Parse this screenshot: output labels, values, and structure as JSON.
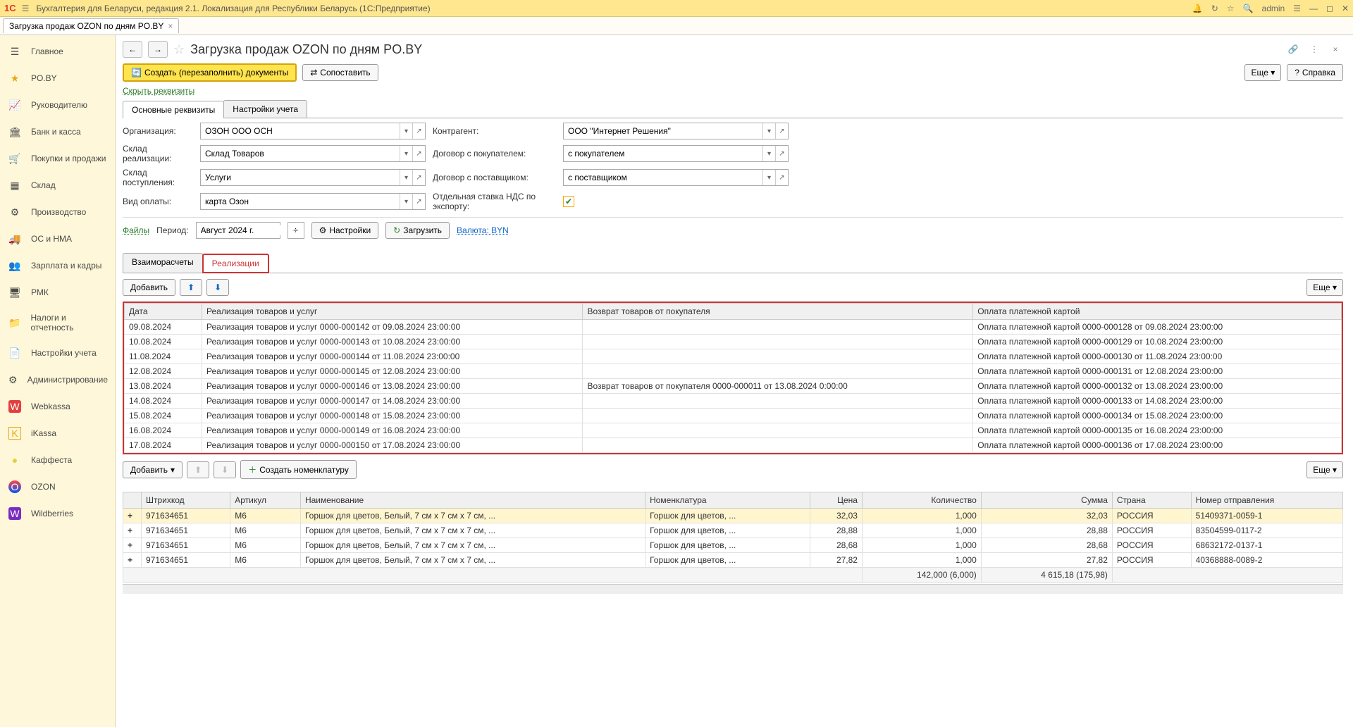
{
  "app": {
    "logo": "1C",
    "title": "Бухгалтерия для Беларуси, редакция 2.1. Локализация для Республики Беларусь  (1С:Предприятие)",
    "user": "admin"
  },
  "tab": {
    "label": "Загрузка продаж OZON по дням PO.BY"
  },
  "sidebar": {
    "items": [
      {
        "label": "Главное"
      },
      {
        "label": "PO.BY"
      },
      {
        "label": "Руководителю"
      },
      {
        "label": "Банк и касса"
      },
      {
        "label": "Покупки и продажи"
      },
      {
        "label": "Склад"
      },
      {
        "label": "Производство"
      },
      {
        "label": "ОС и НМА"
      },
      {
        "label": "Зарплата и кадры"
      },
      {
        "label": "РМК"
      },
      {
        "label": "Налоги и отчетность"
      },
      {
        "label": "Настройки учета"
      },
      {
        "label": "Администрирование"
      },
      {
        "label": "Webkassa"
      },
      {
        "label": "iKassa"
      },
      {
        "label": "Каффеста"
      },
      {
        "label": "OZON"
      },
      {
        "label": "Wildberries"
      }
    ]
  },
  "page": {
    "title": "Загрузка продаж OZON по дням PO.BY",
    "create_btn": "Создать (перезаполнить) документы",
    "compare_btn": "Сопоставить",
    "hide_link": "Скрыть реквизиты",
    "more": "Еще",
    "help": "Справка"
  },
  "formtabs": [
    {
      "label": "Основные реквизиты"
    },
    {
      "label": "Настройки учета"
    }
  ],
  "form": {
    "org_label": "Организация:",
    "org_value": "ОЗОН ООО ОСН",
    "counter_label": "Контрагент:",
    "counter_value": "ООО \"Интернет Решения\"",
    "store_label": "Склад реализации:",
    "store_value": "Склад Товаров",
    "contract_buyer_label": "Договор с покупателем:",
    "contract_buyer_value": "с покупателем",
    "store2_label": "Склад поступления:",
    "store2_value": "Услуги",
    "contract_supplier_label": "Договор с поставщиком:",
    "contract_supplier_value": "с поставщиком",
    "paytype_label": "Вид оплаты:",
    "paytype_value": "карта Озон",
    "export_vat_label": "Отдельная ставка НДС по экспорту:",
    "files": "Файлы",
    "period_label": "Период:",
    "period_value": "Август 2024 г.",
    "settings_btn": "Настройки",
    "load_btn": "Загрузить",
    "currency_link": "Валюта: BYN"
  },
  "subtabs": [
    {
      "label": "Взаиморасчеты"
    },
    {
      "label": "Реализации"
    }
  ],
  "tbbar": {
    "add": "Добавить",
    "more": "Еще"
  },
  "table1": {
    "headers": [
      "Дата",
      "Реализация товаров и услуг",
      "Возврат товаров от покупателя",
      "Оплата платежной картой"
    ],
    "rows": [
      {
        "date": "09.08.2024",
        "real": "Реализация товаров и услуг 0000-000142 от 09.08.2024 23:00:00",
        "ret": "",
        "pay": "Оплата платежной картой 0000-000128 от 09.08.2024 23:00:00"
      },
      {
        "date": "10.08.2024",
        "real": "Реализация товаров и услуг 0000-000143 от 10.08.2024 23:00:00",
        "ret": "",
        "pay": "Оплата платежной картой 0000-000129 от 10.08.2024 23:00:00"
      },
      {
        "date": "11.08.2024",
        "real": "Реализация товаров и услуг 0000-000144 от 11.08.2024 23:00:00",
        "ret": "",
        "pay": "Оплата платежной картой 0000-000130 от 11.08.2024 23:00:00"
      },
      {
        "date": "12.08.2024",
        "real": "Реализация товаров и услуг 0000-000145 от 12.08.2024 23:00:00",
        "ret": "",
        "pay": "Оплата платежной картой 0000-000131 от 12.08.2024 23:00:00"
      },
      {
        "date": "13.08.2024",
        "real": "Реализация товаров и услуг 0000-000146 от 13.08.2024 23:00:00",
        "ret": "Возврат товаров от покупателя 0000-000011 от 13.08.2024 0:00:00",
        "pay": "Оплата платежной картой 0000-000132 от 13.08.2024 23:00:00"
      },
      {
        "date": "14.08.2024",
        "real": "Реализация товаров и услуг 0000-000147 от 14.08.2024 23:00:00",
        "ret": "",
        "pay": "Оплата платежной картой 0000-000133 от 14.08.2024 23:00:00"
      },
      {
        "date": "15.08.2024",
        "real": "Реализация товаров и услуг 0000-000148 от 15.08.2024 23:00:00",
        "ret": "",
        "pay": "Оплата платежной картой 0000-000134 от 15.08.2024 23:00:00"
      },
      {
        "date": "16.08.2024",
        "real": "Реализация товаров и услуг 0000-000149 от 16.08.2024 23:00:00",
        "ret": "",
        "pay": "Оплата платежной картой 0000-000135 от 16.08.2024 23:00:00"
      },
      {
        "date": "17.08.2024",
        "real": "Реализация товаров и услуг 0000-000150 от 17.08.2024 23:00:00",
        "ret": "",
        "pay": "Оплата платежной картой 0000-000136 от 17.08.2024 23:00:00"
      }
    ]
  },
  "tbbar2": {
    "add": "Добавить",
    "create_nom": "Создать номенклатуру",
    "more": "Еще"
  },
  "table2": {
    "headers": [
      "",
      "Штрихкод",
      "Артикул",
      "Наименование",
      "Номенклатура",
      "Цена",
      "Количество",
      "Сумма",
      "Страна",
      "Номер отправления"
    ],
    "rows": [
      {
        "barcode": "971634651",
        "sku": "M6",
        "name": "Горшок для цветов, Белый, 7 см x 7 см x 7 см, ...",
        "nom": "Горшок для цветов, ...",
        "price": "32,03",
        "qty": "1,000",
        "sum": "32,03",
        "country": "РОССИЯ",
        "ship": "51409371-0059-1"
      },
      {
        "barcode": "971634651",
        "sku": "M6",
        "name": "Горшок для цветов, Белый, 7 см x 7 см x 7 см, ...",
        "nom": "Горшок для цветов, ...",
        "price": "28,88",
        "qty": "1,000",
        "sum": "28,88",
        "country": "РОССИЯ",
        "ship": "83504599-0117-2"
      },
      {
        "barcode": "971634651",
        "sku": "M6",
        "name": "Горшок для цветов, Белый, 7 см x 7 см x 7 см, ...",
        "nom": "Горшок для цветов, ...",
        "price": "28,68",
        "qty": "1,000",
        "sum": "28,68",
        "country": "РОССИЯ",
        "ship": "68632172-0137-1"
      },
      {
        "barcode": "971634651",
        "sku": "M6",
        "name": "Горшок для цветов, Белый, 7 см x 7 см x 7 см, ...",
        "nom": "Горшок для цветов, ...",
        "price": "27,82",
        "qty": "1,000",
        "sum": "27,82",
        "country": "РОССИЯ",
        "ship": "40368888-0089-2"
      }
    ],
    "footer": {
      "qty": "142,000 (6,000)",
      "sum": "4 615,18 (175,98)"
    }
  },
  "sidebar_icons": [
    "☰",
    "⭐",
    "📈",
    "🏛",
    "🛒",
    "▦",
    "⚙",
    "🚚",
    "👥",
    "🖥",
    "📁",
    "📄",
    "⚙",
    "W",
    "K",
    "●",
    "O",
    "W"
  ]
}
